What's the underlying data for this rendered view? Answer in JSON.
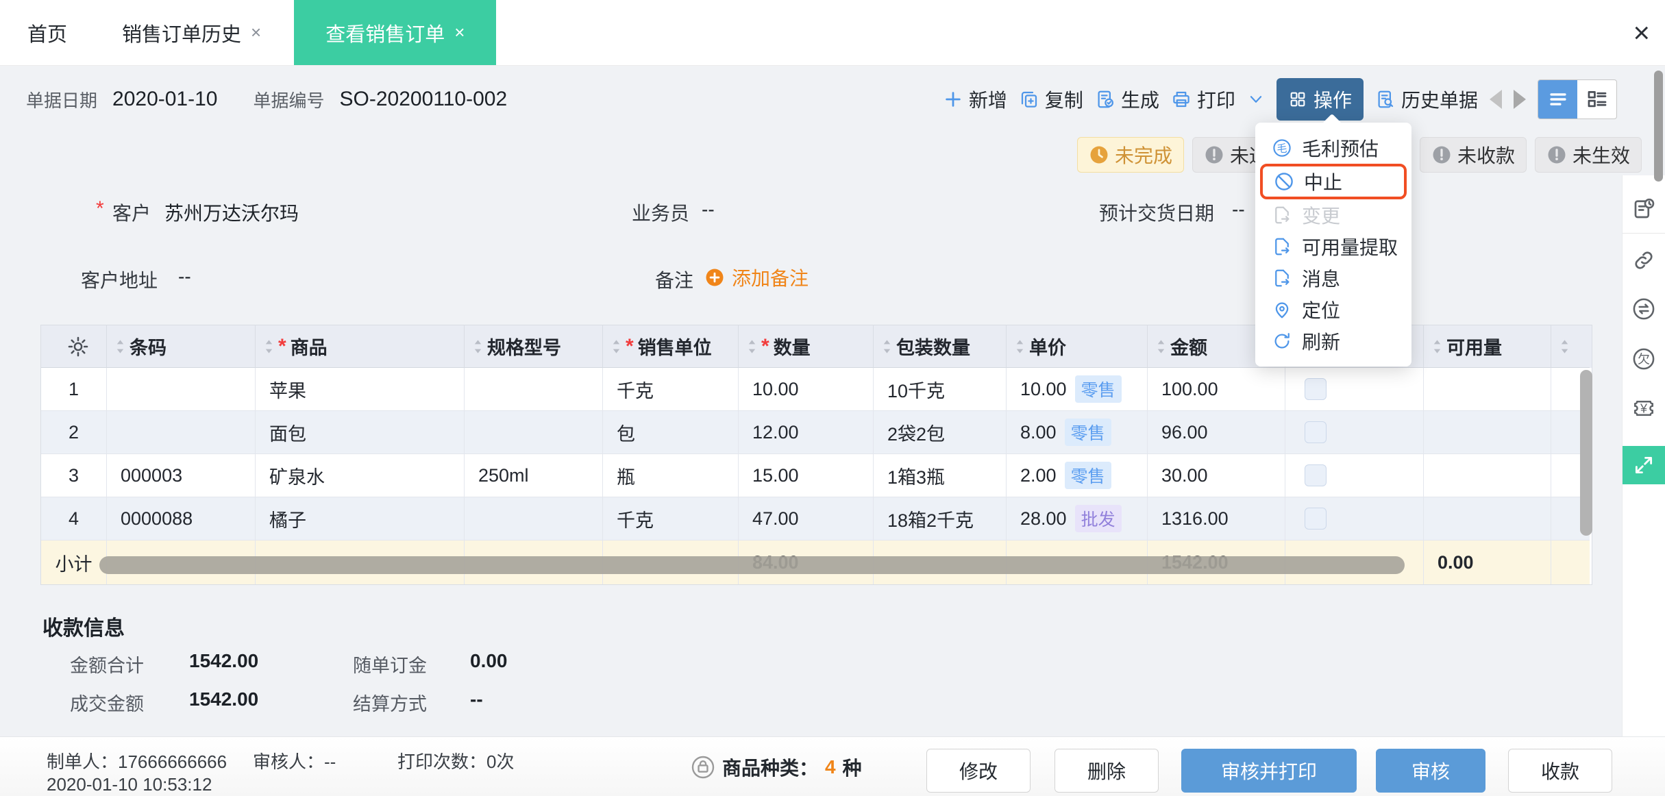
{
  "colors": {
    "accent_teal": "#3CCDA2",
    "primary_blue": "#4E96E9",
    "action_btn_bg": "#3B6C9A",
    "highlight_red": "#F14E23",
    "warning_orange": "#E6A23C",
    "link_orange": "#F08519",
    "footer_btn_blue": "#5B9BD8"
  },
  "tabbar": {
    "tabs": [
      {
        "label": "首页",
        "closable": false,
        "active": false
      },
      {
        "label": "销售订单历史",
        "closable": true,
        "active": false
      },
      {
        "label": "查看销售订单",
        "closable": true,
        "active": true
      }
    ],
    "close_all": "×"
  },
  "doc_header": {
    "date_label": "单据日期",
    "date_value": "2020-01-10",
    "no_label": "单据编号",
    "no_value": "SO-20200110-002"
  },
  "toolbar": {
    "add": "新增",
    "copy": "复制",
    "generate": "生成",
    "print": "打印",
    "action": "操作",
    "history": "历史单据"
  },
  "status_badges": [
    {
      "label": "未完成",
      "type": "warning",
      "icon": "clock"
    },
    {
      "label": "未通知",
      "type": "default",
      "icon": "exclamation"
    },
    {
      "label": "未收款",
      "type": "default",
      "icon": "exclamation"
    },
    {
      "label": "未生效",
      "type": "default",
      "icon": "exclamation"
    }
  ],
  "action_menu": {
    "items": [
      {
        "label": "毛利预估",
        "icon": "profit-circle",
        "highlighted": false,
        "disabled": false
      },
      {
        "label": "中止",
        "icon": "ban",
        "highlighted": true,
        "disabled": false
      },
      {
        "label": "变更",
        "icon": "doc-arrow",
        "highlighted": false,
        "disabled": true
      },
      {
        "label": "可用量提取",
        "icon": "doc-arrow",
        "highlighted": false,
        "disabled": false
      },
      {
        "label": "消息",
        "icon": "doc-arrow",
        "highlighted": false,
        "disabled": false
      },
      {
        "label": "定位",
        "icon": "pin",
        "highlighted": false,
        "disabled": false
      },
      {
        "label": "刷新",
        "icon": "refresh",
        "highlighted": false,
        "disabled": false
      }
    ]
  },
  "form": {
    "customer_label": "客户",
    "customer_value": "苏州万达沃尔玛",
    "salesman_label": "业务员",
    "salesman_value": "--",
    "delivery_label": "预计交货日期",
    "delivery_value": "--",
    "address_label": "客户地址",
    "address_value": "--",
    "remark_label": "备注",
    "remark_add": "添加备注"
  },
  "table": {
    "columns": [
      {
        "key": "barcode",
        "label": "条码",
        "required": false
      },
      {
        "key": "product",
        "label": "商品",
        "required": true
      },
      {
        "key": "spec",
        "label": "规格型号",
        "required": false
      },
      {
        "key": "unit",
        "label": "销售单位",
        "required": true
      },
      {
        "key": "qty",
        "label": "数量",
        "required": true
      },
      {
        "key": "pack_qty",
        "label": "包装数量",
        "required": false
      },
      {
        "key": "price",
        "label": "单价",
        "required": false
      },
      {
        "key": "amount",
        "label": "金额",
        "required": false
      },
      {
        "key": "check",
        "label": "",
        "required": false
      },
      {
        "key": "available",
        "label": "可用量",
        "required": false
      }
    ],
    "rows": [
      {
        "no": "1",
        "barcode": "",
        "product": "苹果",
        "spec": "",
        "unit": "千克",
        "qty": "10.00",
        "pack_qty": "10千克",
        "price": "10.00",
        "price_tag": "零售",
        "tag_type": "retail",
        "amount": "100.00",
        "available": ""
      },
      {
        "no": "2",
        "barcode": "",
        "product": "面包",
        "spec": "",
        "unit": "包",
        "qty": "12.00",
        "pack_qty": "2袋2包",
        "price": "8.00",
        "price_tag": "零售",
        "tag_type": "retail",
        "amount": "96.00",
        "available": ""
      },
      {
        "no": "3",
        "barcode": "000003",
        "product": "矿泉水",
        "spec": "250ml",
        "unit": "瓶",
        "qty": "15.00",
        "pack_qty": "1箱3瓶",
        "price": "2.00",
        "price_tag": "零售",
        "tag_type": "retail",
        "amount": "30.00",
        "available": ""
      },
      {
        "no": "4",
        "barcode": "0000088",
        "product": "橘子",
        "spec": "",
        "unit": "千克",
        "qty": "47.00",
        "pack_qty": "18箱2千克",
        "price": "28.00",
        "price_tag": "批发",
        "tag_type": "wholesale",
        "amount": "1316.00",
        "available": ""
      }
    ],
    "subtotal": {
      "label": "小计",
      "qty": "84.00",
      "amount": "1542.00",
      "available": "0.00"
    }
  },
  "payment": {
    "title": "收款信息",
    "total_label": "金额合计",
    "total_value": "1542.00",
    "deposit_label": "随单订金",
    "deposit_value": "0.00",
    "deal_label": "成交金额",
    "deal_value": "1542.00",
    "settle_label": "结算方式",
    "settle_value": "--"
  },
  "footer": {
    "creator_label": "制单人：",
    "creator_value": "17666666666",
    "created_time": "2020-01-10 10:53:12",
    "auditor_label": "审核人：",
    "auditor_value": "--",
    "print_count_label": "打印次数：",
    "print_count_value": "0次",
    "sku_label": "商品种类：",
    "sku_count": "4",
    "sku_unit": "种",
    "buttons": [
      {
        "label": "修改",
        "variant": "outline"
      },
      {
        "label": "删除",
        "variant": "outline"
      },
      {
        "label": "审核并打印",
        "variant": "primary"
      },
      {
        "label": "审核",
        "variant": "primary"
      },
      {
        "label": "收款",
        "variant": "outline"
      }
    ]
  },
  "sidebar_icons": [
    "doc-clock",
    "link",
    "exchange-circle",
    "owe-circle",
    "yen-voucher",
    "expand"
  ]
}
